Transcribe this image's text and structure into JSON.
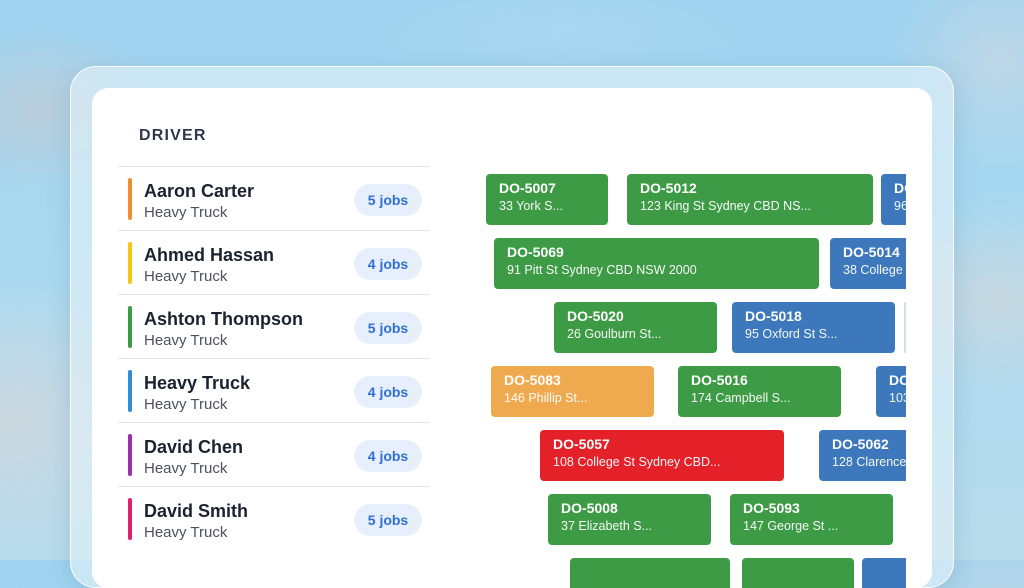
{
  "header": {
    "driver_label": "DRIVER"
  },
  "drivers": [
    {
      "name": "Aaron Carter",
      "vehicle": "Heavy Truck",
      "jobs": "5 jobs",
      "color": "#f0902a"
    },
    {
      "name": "Ahmed Hassan",
      "vehicle": "Heavy Truck",
      "jobs": "4 jobs",
      "color": "#f5c518"
    },
    {
      "name": "Ashton Thompson",
      "vehicle": "Heavy Truck",
      "jobs": "5 jobs",
      "color": "#3d9b46"
    },
    {
      "name": "Heavy Truck",
      "vehicle": "Heavy Truck",
      "jobs": "4 jobs",
      "color": "#2c8fd8"
    },
    {
      "name": "David Chen",
      "vehicle": "Heavy Truck",
      "jobs": "4 jobs",
      "color": "#9b2fae"
    },
    {
      "name": "David Smith",
      "vehicle": "Heavy Truck",
      "jobs": "5 jobs",
      "color": "#e02070"
    }
  ],
  "jobs": [
    [
      {
        "id": "DO-5007",
        "address": "33 York S...",
        "status": "green"
      },
      {
        "id": "DO-5012",
        "address": "123 King St Sydney CBD NS...",
        "status": "green"
      },
      {
        "id": "DO",
        "address": "96",
        "status": "blue"
      }
    ],
    [
      {
        "id": "DO-5069",
        "address": "91 Pitt St Sydney CBD NSW 2000",
        "status": "green"
      },
      {
        "id": "DO-5014",
        "address": "38 College",
        "status": "blue"
      }
    ],
    [
      {
        "id": "DO-5020",
        "address": "26 Goulburn St...",
        "status": "green"
      },
      {
        "id": "DO-5018",
        "address": "95 Oxford St S...",
        "status": "blue"
      }
    ],
    [
      {
        "id": "DO-5083",
        "address": "146 Phillip St...",
        "status": "orange"
      },
      {
        "id": "DO-5016",
        "address": "174 Campbell S...",
        "status": "green"
      },
      {
        "id": "DC",
        "address": "103",
        "status": "blue"
      }
    ],
    [
      {
        "id": "DO-5057",
        "address": "108 College St Sydney CBD...",
        "status": "red"
      },
      {
        "id": "DO-5062",
        "address": "128 Clarence",
        "status": "blue"
      }
    ],
    [
      {
        "id": "DO-5008",
        "address": "37 Elizabeth S...",
        "status": "green"
      },
      {
        "id": "DO-5093",
        "address": "147 George St ...",
        "status": "green"
      }
    ]
  ]
}
